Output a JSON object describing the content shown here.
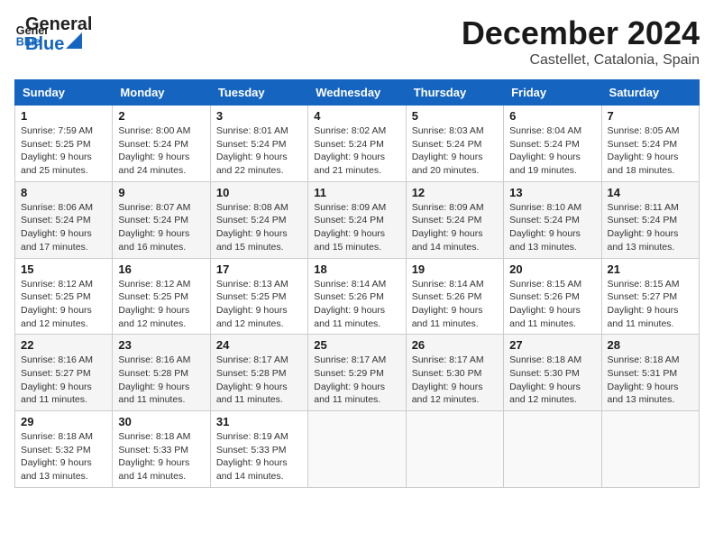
{
  "header": {
    "logo_general": "General",
    "logo_blue": "Blue",
    "month_title": "December 2024",
    "location": "Castellet, Catalonia, Spain"
  },
  "calendar": {
    "columns": [
      "Sunday",
      "Monday",
      "Tuesday",
      "Wednesday",
      "Thursday",
      "Friday",
      "Saturday"
    ],
    "rows": [
      [
        {
          "day": "1",
          "sunrise": "Sunrise: 7:59 AM",
          "sunset": "Sunset: 5:25 PM",
          "daylight": "Daylight: 9 hours and 25 minutes."
        },
        {
          "day": "2",
          "sunrise": "Sunrise: 8:00 AM",
          "sunset": "Sunset: 5:24 PM",
          "daylight": "Daylight: 9 hours and 24 minutes."
        },
        {
          "day": "3",
          "sunrise": "Sunrise: 8:01 AM",
          "sunset": "Sunset: 5:24 PM",
          "daylight": "Daylight: 9 hours and 22 minutes."
        },
        {
          "day": "4",
          "sunrise": "Sunrise: 8:02 AM",
          "sunset": "Sunset: 5:24 PM",
          "daylight": "Daylight: 9 hours and 21 minutes."
        },
        {
          "day": "5",
          "sunrise": "Sunrise: 8:03 AM",
          "sunset": "Sunset: 5:24 PM",
          "daylight": "Daylight: 9 hours and 20 minutes."
        },
        {
          "day": "6",
          "sunrise": "Sunrise: 8:04 AM",
          "sunset": "Sunset: 5:24 PM",
          "daylight": "Daylight: 9 hours and 19 minutes."
        },
        {
          "day": "7",
          "sunrise": "Sunrise: 8:05 AM",
          "sunset": "Sunset: 5:24 PM",
          "daylight": "Daylight: 9 hours and 18 minutes."
        }
      ],
      [
        {
          "day": "8",
          "sunrise": "Sunrise: 8:06 AM",
          "sunset": "Sunset: 5:24 PM",
          "daylight": "Daylight: 9 hours and 17 minutes."
        },
        {
          "day": "9",
          "sunrise": "Sunrise: 8:07 AM",
          "sunset": "Sunset: 5:24 PM",
          "daylight": "Daylight: 9 hours and 16 minutes."
        },
        {
          "day": "10",
          "sunrise": "Sunrise: 8:08 AM",
          "sunset": "Sunset: 5:24 PM",
          "daylight": "Daylight: 9 hours and 15 minutes."
        },
        {
          "day": "11",
          "sunrise": "Sunrise: 8:09 AM",
          "sunset": "Sunset: 5:24 PM",
          "daylight": "Daylight: 9 hours and 15 minutes."
        },
        {
          "day": "12",
          "sunrise": "Sunrise: 8:09 AM",
          "sunset": "Sunset: 5:24 PM",
          "daylight": "Daylight: 9 hours and 14 minutes."
        },
        {
          "day": "13",
          "sunrise": "Sunrise: 8:10 AM",
          "sunset": "Sunset: 5:24 PM",
          "daylight": "Daylight: 9 hours and 13 minutes."
        },
        {
          "day": "14",
          "sunrise": "Sunrise: 8:11 AM",
          "sunset": "Sunset: 5:24 PM",
          "daylight": "Daylight: 9 hours and 13 minutes."
        }
      ],
      [
        {
          "day": "15",
          "sunrise": "Sunrise: 8:12 AM",
          "sunset": "Sunset: 5:25 PM",
          "daylight": "Daylight: 9 hours and 12 minutes."
        },
        {
          "day": "16",
          "sunrise": "Sunrise: 8:12 AM",
          "sunset": "Sunset: 5:25 PM",
          "daylight": "Daylight: 9 hours and 12 minutes."
        },
        {
          "day": "17",
          "sunrise": "Sunrise: 8:13 AM",
          "sunset": "Sunset: 5:25 PM",
          "daylight": "Daylight: 9 hours and 12 minutes."
        },
        {
          "day": "18",
          "sunrise": "Sunrise: 8:14 AM",
          "sunset": "Sunset: 5:26 PM",
          "daylight": "Daylight: 9 hours and 11 minutes."
        },
        {
          "day": "19",
          "sunrise": "Sunrise: 8:14 AM",
          "sunset": "Sunset: 5:26 PM",
          "daylight": "Daylight: 9 hours and 11 minutes."
        },
        {
          "day": "20",
          "sunrise": "Sunrise: 8:15 AM",
          "sunset": "Sunset: 5:26 PM",
          "daylight": "Daylight: 9 hours and 11 minutes."
        },
        {
          "day": "21",
          "sunrise": "Sunrise: 8:15 AM",
          "sunset": "Sunset: 5:27 PM",
          "daylight": "Daylight: 9 hours and 11 minutes."
        }
      ],
      [
        {
          "day": "22",
          "sunrise": "Sunrise: 8:16 AM",
          "sunset": "Sunset: 5:27 PM",
          "daylight": "Daylight: 9 hours and 11 minutes."
        },
        {
          "day": "23",
          "sunrise": "Sunrise: 8:16 AM",
          "sunset": "Sunset: 5:28 PM",
          "daylight": "Daylight: 9 hours and 11 minutes."
        },
        {
          "day": "24",
          "sunrise": "Sunrise: 8:17 AM",
          "sunset": "Sunset: 5:28 PM",
          "daylight": "Daylight: 9 hours and 11 minutes."
        },
        {
          "day": "25",
          "sunrise": "Sunrise: 8:17 AM",
          "sunset": "Sunset: 5:29 PM",
          "daylight": "Daylight: 9 hours and 11 minutes."
        },
        {
          "day": "26",
          "sunrise": "Sunrise: 8:17 AM",
          "sunset": "Sunset: 5:30 PM",
          "daylight": "Daylight: 9 hours and 12 minutes."
        },
        {
          "day": "27",
          "sunrise": "Sunrise: 8:18 AM",
          "sunset": "Sunset: 5:30 PM",
          "daylight": "Daylight: 9 hours and 12 minutes."
        },
        {
          "day": "28",
          "sunrise": "Sunrise: 8:18 AM",
          "sunset": "Sunset: 5:31 PM",
          "daylight": "Daylight: 9 hours and 13 minutes."
        }
      ],
      [
        {
          "day": "29",
          "sunrise": "Sunrise: 8:18 AM",
          "sunset": "Sunset: 5:32 PM",
          "daylight": "Daylight: 9 hours and 13 minutes."
        },
        {
          "day": "30",
          "sunrise": "Sunrise: 8:18 AM",
          "sunset": "Sunset: 5:33 PM",
          "daylight": "Daylight: 9 hours and 14 minutes."
        },
        {
          "day": "31",
          "sunrise": "Sunrise: 8:19 AM",
          "sunset": "Sunset: 5:33 PM",
          "daylight": "Daylight: 9 hours and 14 minutes."
        },
        {
          "day": "",
          "sunrise": "",
          "sunset": "",
          "daylight": ""
        },
        {
          "day": "",
          "sunrise": "",
          "sunset": "",
          "daylight": ""
        },
        {
          "day": "",
          "sunrise": "",
          "sunset": "",
          "daylight": ""
        },
        {
          "day": "",
          "sunrise": "",
          "sunset": "",
          "daylight": ""
        }
      ]
    ]
  }
}
